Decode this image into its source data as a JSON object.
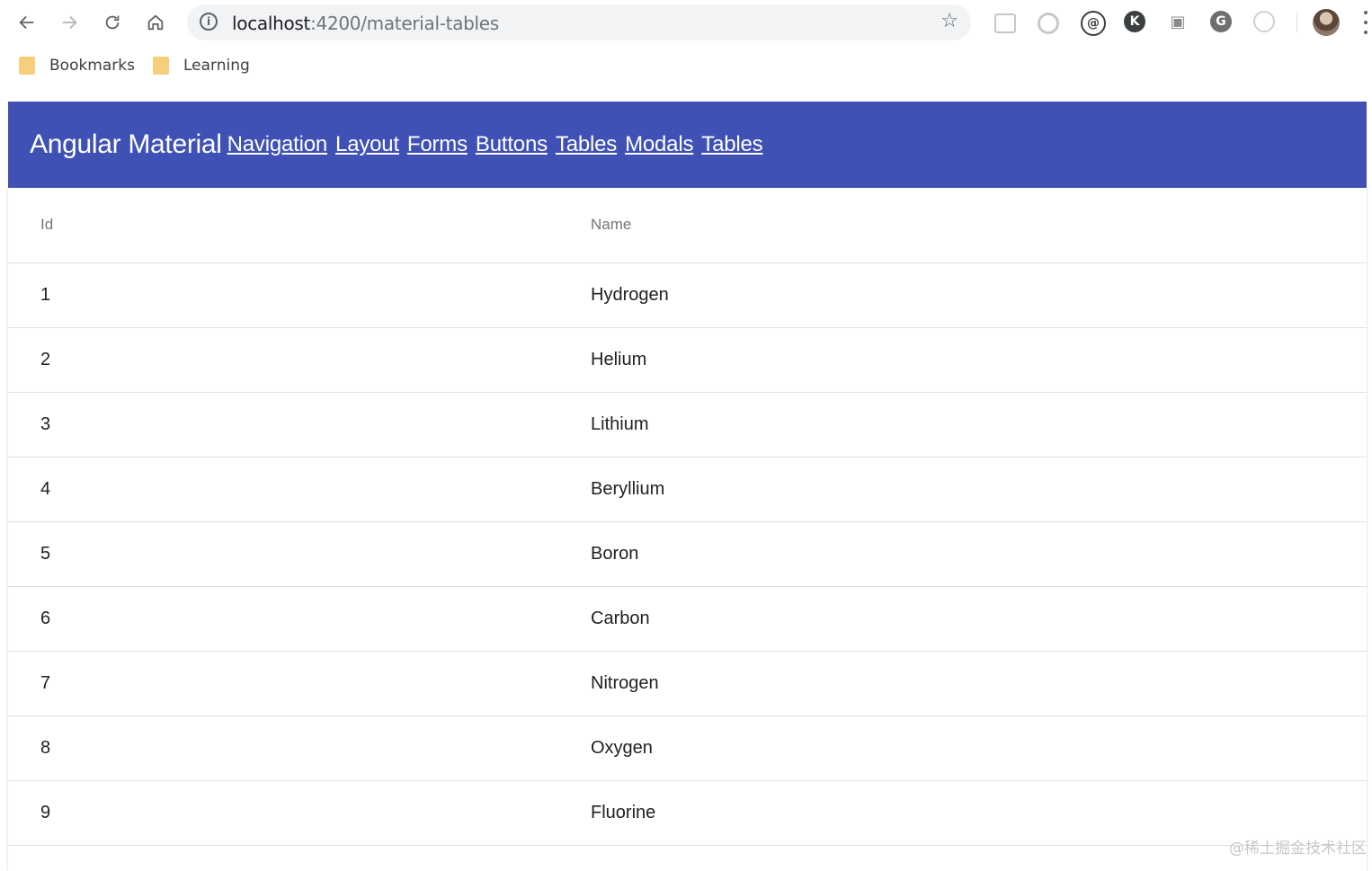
{
  "browser": {
    "url_host": "localhost",
    "url_path": ":4200/material-tables",
    "bookmarks": [
      {
        "label": "Bookmarks"
      },
      {
        "label": "Learning"
      }
    ]
  },
  "app": {
    "brand": "Angular Material",
    "nav": [
      "Navigation",
      "Layout",
      "Forms",
      "Buttons",
      "Tables",
      "Modals",
      "Tables"
    ],
    "colors": {
      "header": "#3f51b5",
      "header_text": "#ffffff"
    }
  },
  "table": {
    "headers": {
      "id": "Id",
      "name": "Name"
    },
    "rows": [
      {
        "id": "1",
        "name": "Hydrogen"
      },
      {
        "id": "2",
        "name": "Helium"
      },
      {
        "id": "3",
        "name": "Lithium"
      },
      {
        "id": "4",
        "name": "Beryllium"
      },
      {
        "id": "5",
        "name": "Boron"
      },
      {
        "id": "6",
        "name": "Carbon"
      },
      {
        "id": "7",
        "name": "Nitrogen"
      },
      {
        "id": "8",
        "name": "Oxygen"
      },
      {
        "id": "9",
        "name": "Fluorine"
      }
    ]
  },
  "watermark": "@稀土掘金技术社区"
}
